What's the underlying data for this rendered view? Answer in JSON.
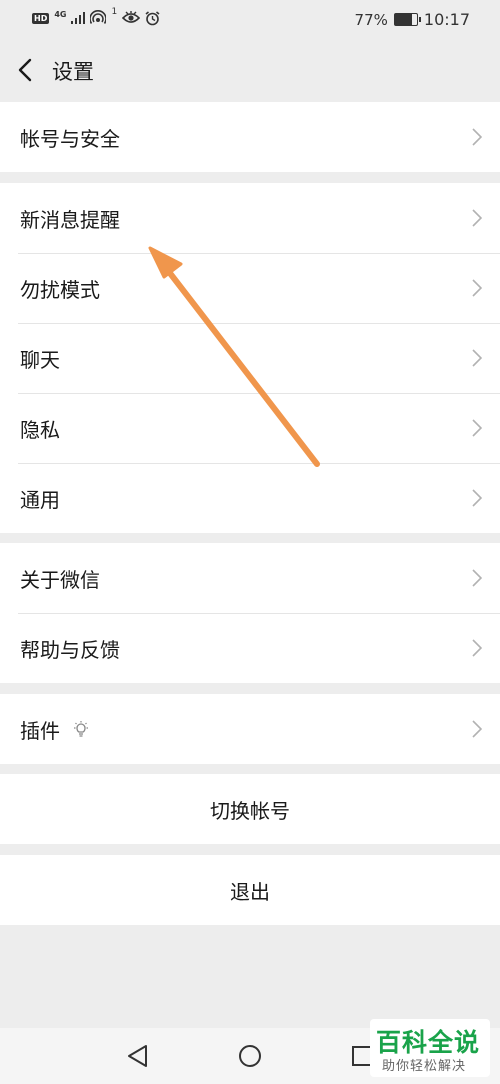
{
  "status_bar": {
    "hd": "HD",
    "network": "4G",
    "notification_count": "1",
    "battery": "77%",
    "battery_level_percent": 77,
    "time": "10:17"
  },
  "nav": {
    "title": "设置"
  },
  "groups": {
    "account": {
      "items": [
        "帐号与安全"
      ]
    },
    "preferences": {
      "items": [
        "新消息提醒",
        "勿扰模式",
        "聊天",
        "隐私",
        "通用"
      ]
    },
    "about": {
      "items": [
        "关于微信",
        "帮助与反馈"
      ]
    },
    "plugins": {
      "items": [
        "插件"
      ]
    }
  },
  "actions": {
    "switch_account": "切换帐号",
    "logout": "退出"
  },
  "watermark": {
    "brand": "百科全说",
    "slogan": "助你轻松解决"
  },
  "colors": {
    "background": "#ededed",
    "card": "#ffffff",
    "arrow": "#f0964c",
    "watermark_green": "#1aa34a"
  },
  "icons": {
    "back": "chevron-left-icon",
    "row_chevron": "chevron-right-icon",
    "plugin": "plugin-bulb-icon",
    "sys_back": "triangle-back-icon",
    "sys_home": "circle-home-icon",
    "sys_recent": "square-recent-icon"
  }
}
